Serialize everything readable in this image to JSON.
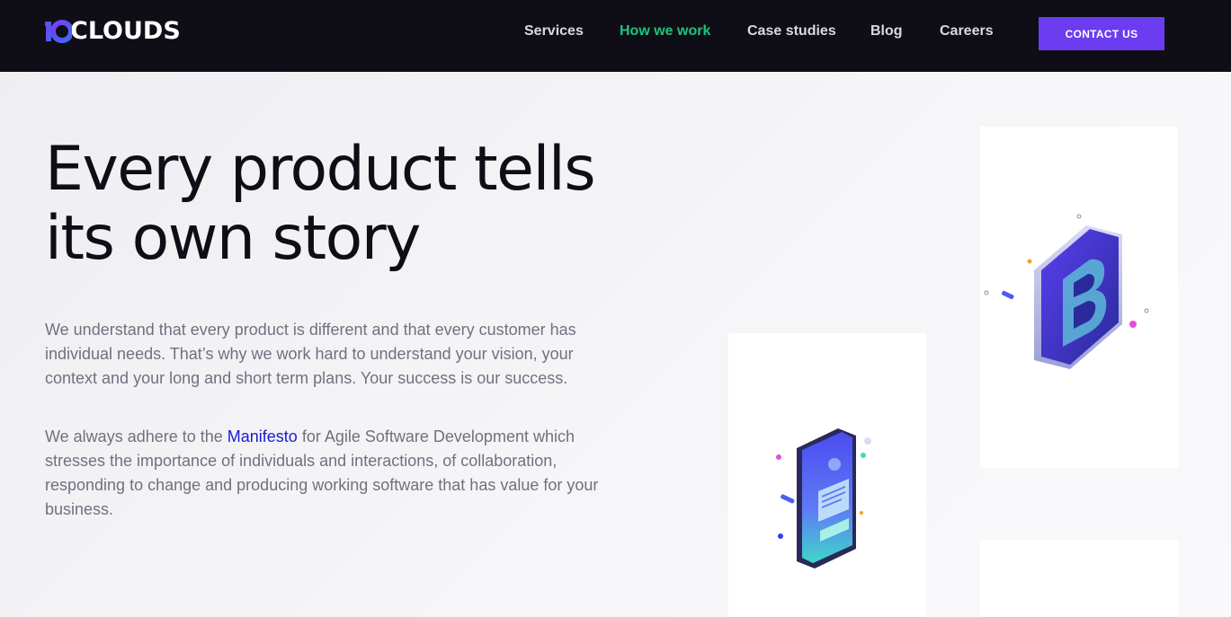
{
  "header": {
    "logo_text": "CLOUDS",
    "logo_mark": "10",
    "nav": [
      {
        "label": "Services"
      },
      {
        "label": "How we work"
      },
      {
        "label": "Case studies"
      },
      {
        "label": "Blog"
      },
      {
        "label": "Careers"
      }
    ],
    "active_nav": "How we work",
    "contact_label": "CONTACT US"
  },
  "hero": {
    "title_line1": "Every product tells",
    "title_line2": "its own story",
    "paragraph1": "We understand that every product is different and that every customer has individual needs. That’s why we work hard to understand your vision, your context and your long and short term plans. Your success is our success.",
    "paragraph2_before": "We always adhere to the ",
    "paragraph2_link": "Manifesto",
    "paragraph2_after": " for Agile Software Development which stresses the importance of individuals and interactions, of collaboration, responding to change and producing working software that has value for your business."
  },
  "illustrations": [
    {
      "name": "letter-b-tile-icon",
      "card": 1
    },
    {
      "name": "smartphone-icon",
      "card": 2
    }
  ],
  "colors": {
    "header_bg": "#0f0e16",
    "accent": "#6c3cf0",
    "active_nav": "#1ec47c",
    "link": "#1a1acf",
    "body_text": "#707080"
  }
}
